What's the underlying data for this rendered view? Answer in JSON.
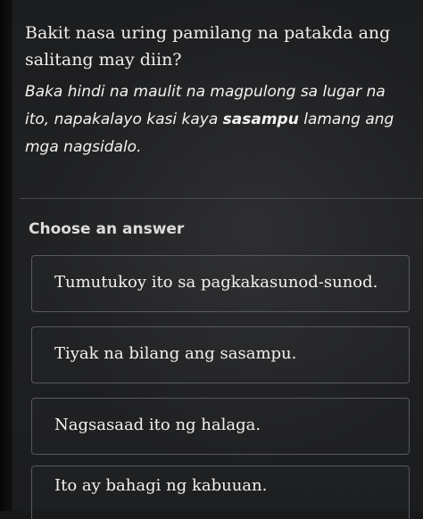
{
  "question": {
    "prompt_line1": "Bakit nasa uring pamilang na patakda ang",
    "prompt_line2": "salitang may diin?",
    "passage_line1": "Baka hindi na maulit na magpulong sa lugar na",
    "passage_line2_a": "ito, napakalayo kasi kaya ",
    "passage_emphasis": "sasampu",
    "passage_line2_b": " lamang ang",
    "passage_line3": "mga nagsidalo."
  },
  "answers": {
    "heading": "Choose an answer",
    "options": [
      "Tumutukoy ito sa pagkakasunod-sunod.",
      "Tiyak na bilang ang sasampu.",
      "Nagsasaad ito ng halaga.",
      "Ito ay bahagi ng kabuuan."
    ]
  }
}
